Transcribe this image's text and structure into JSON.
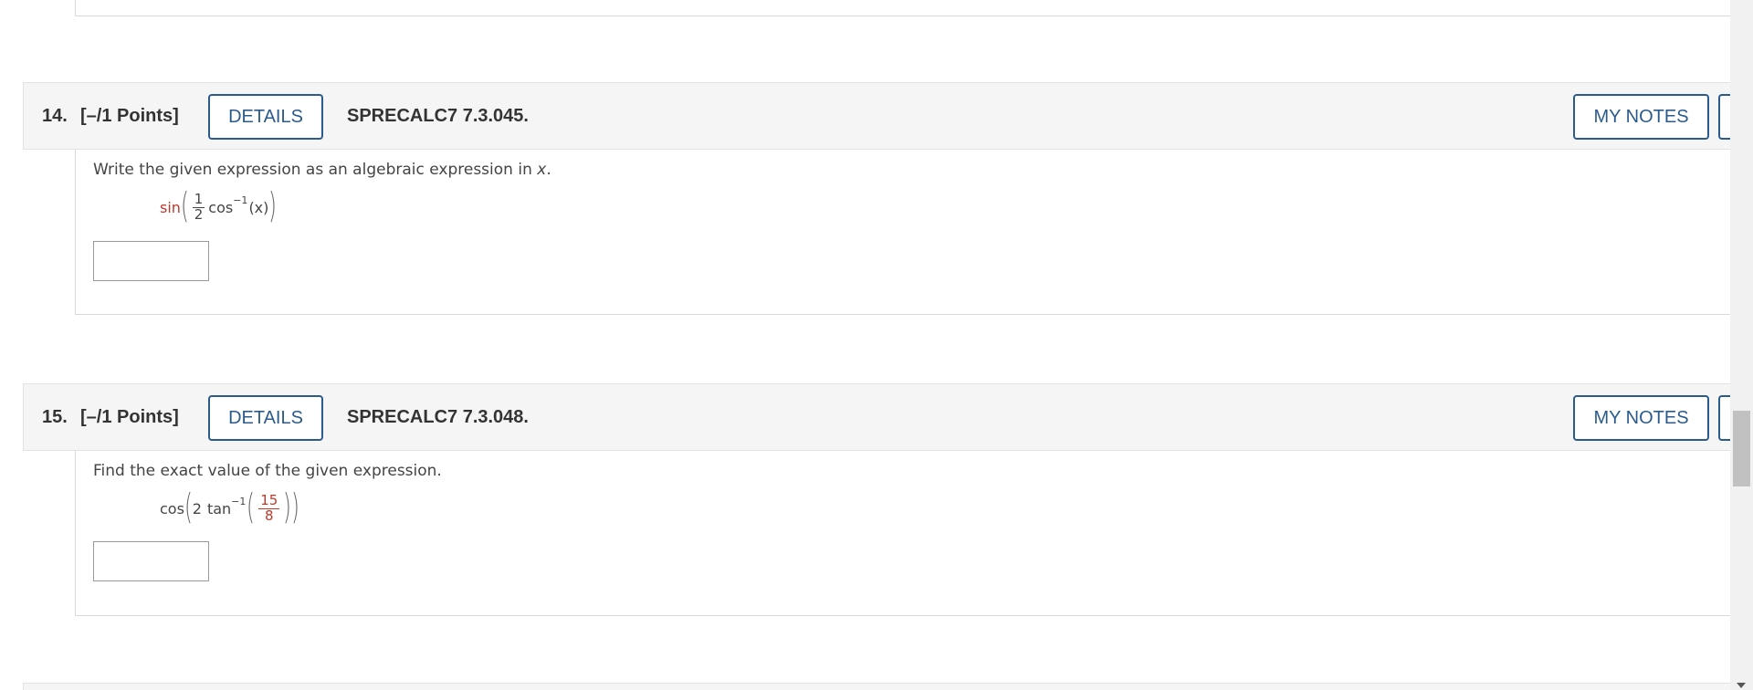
{
  "questions": [
    {
      "number": "14.",
      "points": "[–/1 Points]",
      "details_label": "DETAILS",
      "code": "SPRECALC7 7.3.045.",
      "notes_label": "MY NOTES",
      "prompt_before": "Write the given expression as an algebraic expression in ",
      "prompt_var": "x",
      "prompt_after": ".",
      "expr": {
        "fn": "sin",
        "frac_num": "1",
        "frac_den": "2",
        "inner_fn": "cos",
        "sup": "−1",
        "arg": "(x)"
      },
      "answer_value": ""
    },
    {
      "number": "15.",
      "points": "[–/1 Points]",
      "details_label": "DETAILS",
      "code": "SPRECALC7 7.3.048.",
      "notes_label": "MY NOTES",
      "prompt": "Find the exact value of the given expression.",
      "expr": {
        "fn": "cos",
        "coef": "2",
        "inner_fn": "tan",
        "sup": "−1",
        "frac_num": "15",
        "frac_den": "8"
      },
      "answer_value": ""
    }
  ],
  "colors": {
    "button_border": "#2b5b8c",
    "highlight_red": "#c0392b",
    "header_bg": "#f5f5f5"
  }
}
